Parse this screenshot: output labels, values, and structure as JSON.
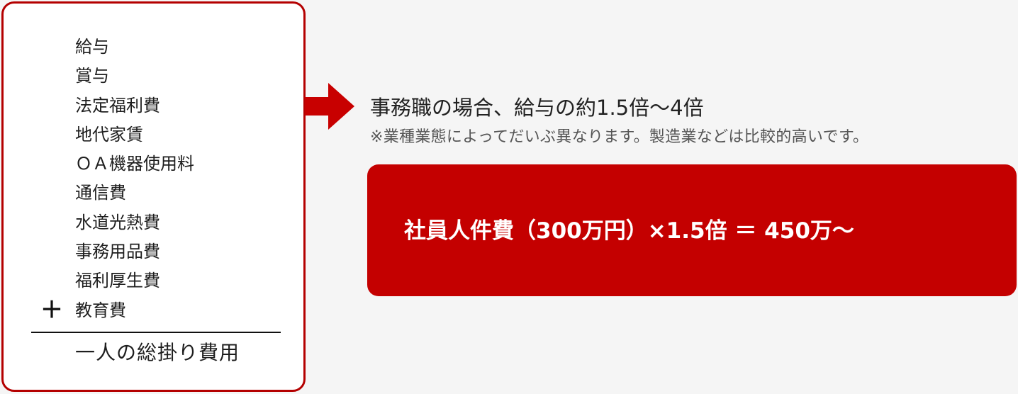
{
  "cost_breakdown": {
    "items": [
      "給与",
      "賞与",
      "法定福利費",
      "地代家賃",
      "ＯＡ機器使用料",
      "通信費",
      "水道光熱費",
      "事務用品費",
      "福利厚生費",
      "教育費"
    ],
    "operator": "＋",
    "total_label": "一人の総掛り費用"
  },
  "result": {
    "headline": "事務職の場合、給与の約1.5倍～4倍",
    "note": "※業種業態によってだいぶ異なります。製造業などは比較的高いです。",
    "formula": "社員人件費（300万円）×1.5倍 ＝ 450万～"
  },
  "colors": {
    "accent_red": "#c40000",
    "border_red": "#b40000",
    "background": "#f5f5f5"
  },
  "icons": {
    "arrow": "right-arrow-icon"
  }
}
